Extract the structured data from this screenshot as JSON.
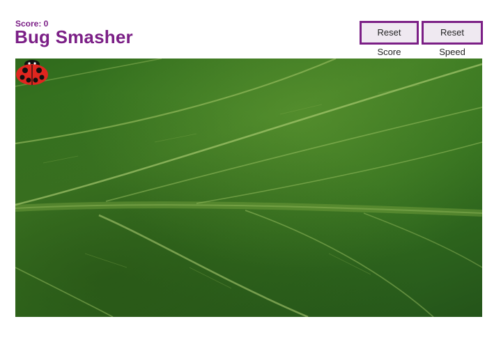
{
  "header": {
    "score_text": "Score: 0",
    "title": "Bug Smasher"
  },
  "controls": {
    "reset_score_label": "Reset Score",
    "reset_speed_label": "Reset Speed"
  },
  "game": {
    "background": "leaf",
    "bug_type": "ladybug",
    "colors": {
      "accent": "#7b1f86",
      "button_bg": "#efe9f1",
      "leaf": "#3f7d24",
      "bug_shell": "#e0261f",
      "bug_spots": "#111111"
    }
  }
}
